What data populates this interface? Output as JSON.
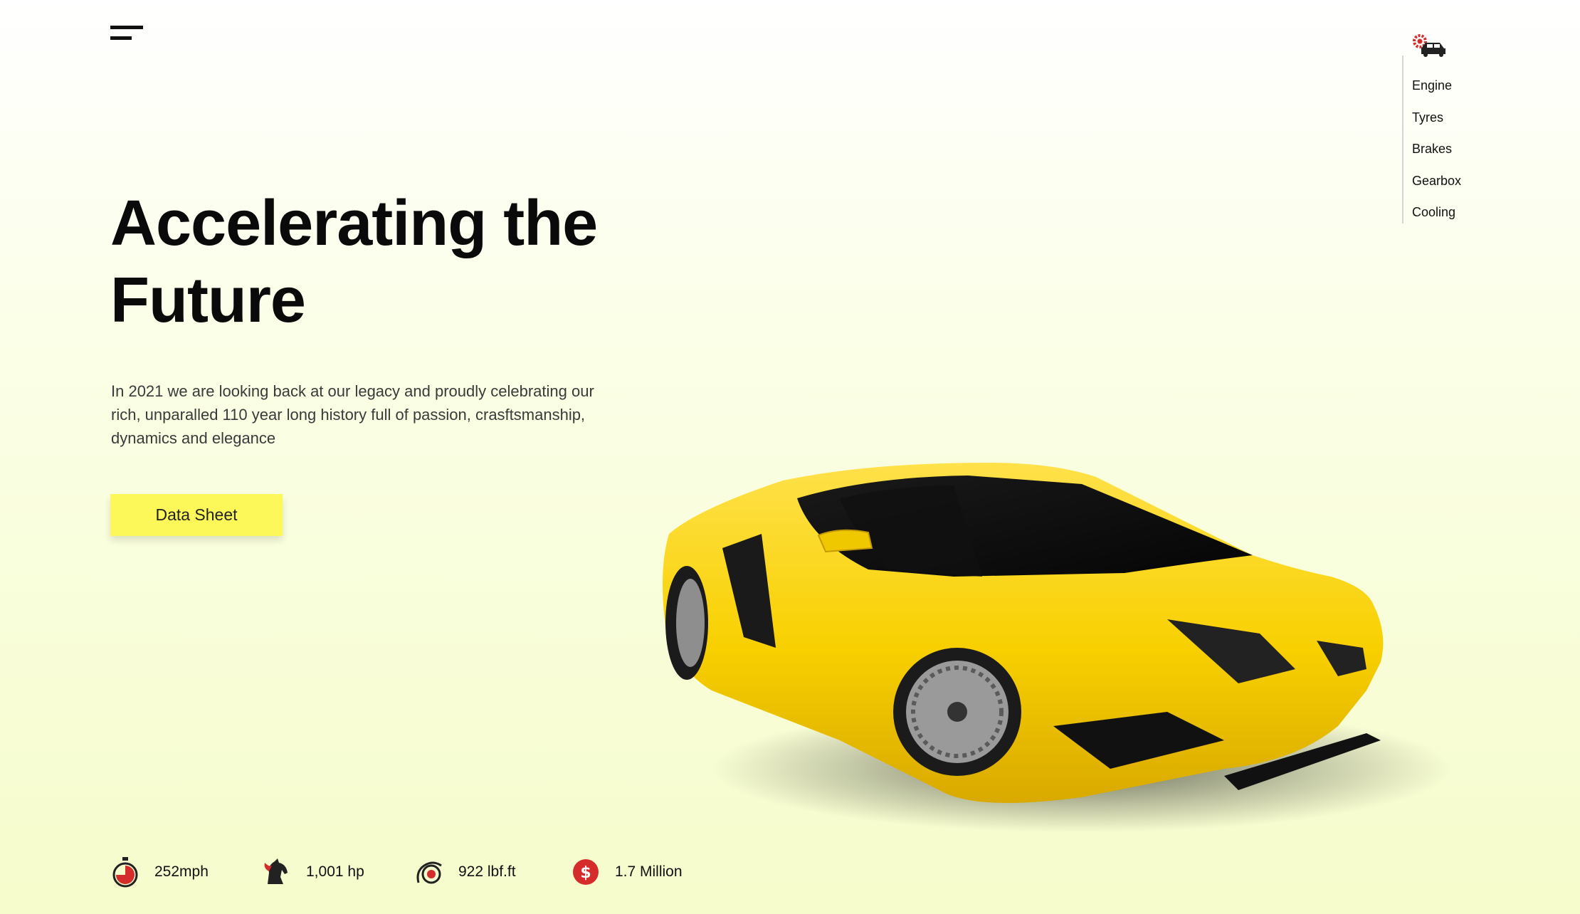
{
  "nav": {
    "items": [
      {
        "label": "Engine"
      },
      {
        "label": "Tyres"
      },
      {
        "label": "Brakes"
      },
      {
        "label": "Gearbox"
      },
      {
        "label": "Cooling"
      }
    ]
  },
  "hero": {
    "title_line1": "Accelerating the",
    "title_line2": "Future",
    "description": "In 2021 we are looking back at our legacy and proudly celebrating our rich, unparalled 110 year long history full of passion, crasftsmanship, dynamics and elegance",
    "cta_label": "Data Sheet"
  },
  "stats": [
    {
      "icon": "stopwatch-icon",
      "value": "252mph"
    },
    {
      "icon": "horse-icon",
      "value": "1,001 hp"
    },
    {
      "icon": "turbo-icon",
      "value": "922 lbf.ft"
    },
    {
      "icon": "dollar-icon",
      "value": "1.7 Million"
    }
  ],
  "colors": {
    "accent": "#fcf85a",
    "car_yellow": "#f8d000",
    "icon_red": "#d62b2b",
    "text": "#111111"
  }
}
